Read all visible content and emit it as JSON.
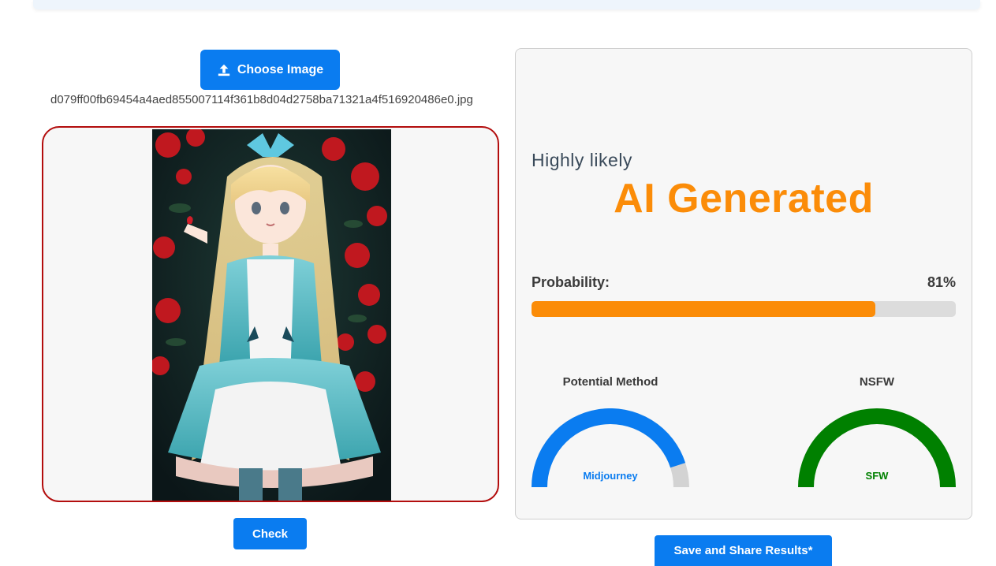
{
  "upload": {
    "choose_label": "Choose Image",
    "filename": "d079ff00fb69454a4aed855007114f361b8d04d2758ba71321a4f516920486e0.jpg"
  },
  "actions": {
    "check_label": "Check",
    "save_label": "Save and Share Results*"
  },
  "result": {
    "likelihood": "Highly likely",
    "verdict": "AI Generated",
    "probability_label": "Probability:",
    "probability_text": "81%",
    "probability": 0.81,
    "method": {
      "title": "Potential Method",
      "value": "Midjourney",
      "level": 0.9,
      "color": "#0a7cf0"
    },
    "nsfw": {
      "title": "NSFW",
      "value": "SFW",
      "level": 1.0,
      "color": "#008000"
    }
  },
  "colors": {
    "accent": "#0a7cf0",
    "verdict": "#fb8c08",
    "frame": "#b30d0d"
  },
  "icons": {
    "upload": "upload-icon"
  }
}
